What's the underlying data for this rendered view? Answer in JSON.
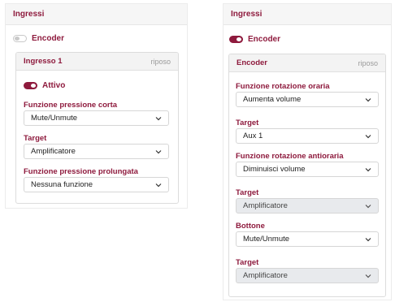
{
  "left": {
    "title": "Ingressi",
    "encoder_toggle": {
      "label": "Encoder",
      "on": false
    },
    "card": {
      "title": "Ingresso 1",
      "status": "riposo",
      "active_toggle": {
        "label": "Attivo",
        "on": true
      },
      "fields": [
        {
          "label": "Funzione pressione corta",
          "value": "Mute/Unmute"
        },
        {
          "label": "Target",
          "value": "Amplificatore"
        },
        {
          "label": "Funzione pressione prolungata",
          "value": "Nessuna funzione"
        }
      ]
    }
  },
  "right": {
    "title": "Ingressi",
    "encoder_toggle": {
      "label": "Encoder",
      "on": true
    },
    "card": {
      "title": "Encoder",
      "status": "riposo",
      "fields": [
        {
          "label": "Funzione rotazione oraria",
          "value": "Aumenta volume",
          "disabled": false
        },
        {
          "label": "Target",
          "value": "Aux 1",
          "disabled": false
        },
        {
          "label": "Funzione rotazione antioraria",
          "value": "Diminuisci volume",
          "disabled": false
        },
        {
          "label": "Target",
          "value": "Amplificatore",
          "disabled": true
        },
        {
          "label": "Bottone",
          "value": "Mute/Unmute",
          "disabled": false
        },
        {
          "label": "Target",
          "value": "Amplificatore",
          "disabled": true
        }
      ]
    }
  },
  "icons": {
    "select_arrow": "chevron-down-icon"
  },
  "colors": {
    "accent": "#8e1a3d",
    "disabled_bg": "#e8eaed"
  }
}
